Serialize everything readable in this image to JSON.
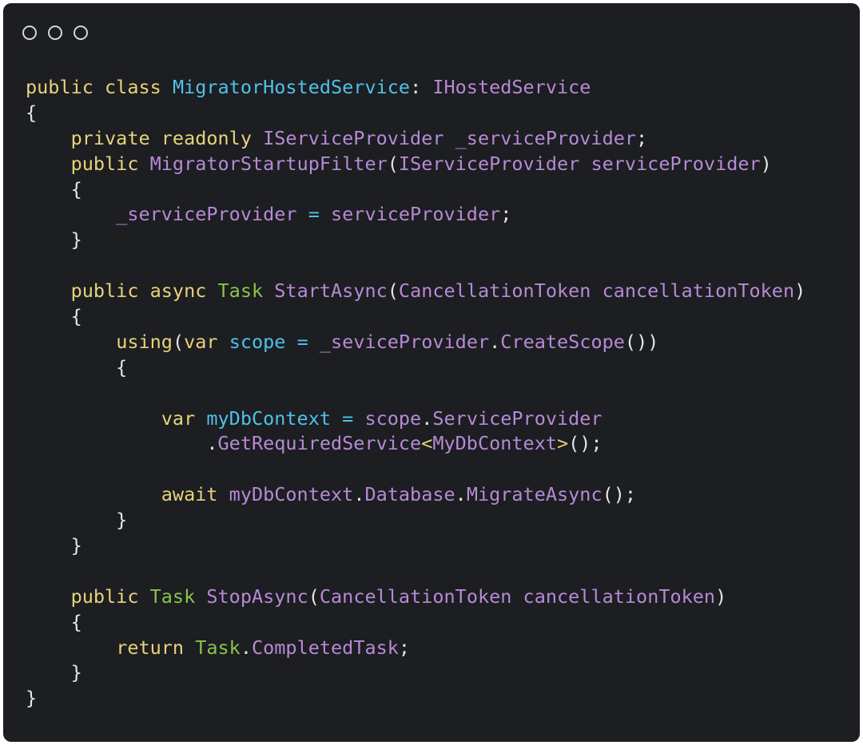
{
  "window": {
    "controls": [
      "circle-icon",
      "circle-icon",
      "circle-icon"
    ]
  },
  "code": {
    "lines": [
      [
        {
          "t": "public class ",
          "k": "kw"
        },
        {
          "t": "MigratorHostedService",
          "k": "cls"
        },
        {
          "t": ": ",
          "k": "punct"
        },
        {
          "t": "IHostedService",
          "k": "type"
        }
      ],
      [
        {
          "t": "{",
          "k": "punct"
        }
      ],
      [
        {
          "t": "    ",
          "k": "punct"
        },
        {
          "t": "private readonly ",
          "k": "kw"
        },
        {
          "t": "IServiceProvider _serviceProvider",
          "k": "type"
        },
        {
          "t": ";",
          "k": "punct"
        }
      ],
      [
        {
          "t": "    ",
          "k": "punct"
        },
        {
          "t": "public ",
          "k": "kw"
        },
        {
          "t": "MigratorStartupFilter",
          "k": "type"
        },
        {
          "t": "(",
          "k": "punct"
        },
        {
          "t": "IServiceProvider serviceProvider",
          "k": "type"
        },
        {
          "t": ")",
          "k": "punct"
        }
      ],
      [
        {
          "t": "    {",
          "k": "punct"
        }
      ],
      [
        {
          "t": "        ",
          "k": "punct"
        },
        {
          "t": "_serviceProvider",
          "k": "type"
        },
        {
          "t": " = ",
          "k": "op"
        },
        {
          "t": "serviceProvider",
          "k": "type"
        },
        {
          "t": ";",
          "k": "punct"
        }
      ],
      [
        {
          "t": "    }",
          "k": "punct"
        }
      ],
      [
        {
          "t": "",
          "k": "punct"
        }
      ],
      [
        {
          "t": "    ",
          "k": "punct"
        },
        {
          "t": "public async ",
          "k": "kw"
        },
        {
          "t": "Task ",
          "k": "task"
        },
        {
          "t": "StartAsync",
          "k": "type"
        },
        {
          "t": "(",
          "k": "punct"
        },
        {
          "t": "CancellationToken cancellationToken",
          "k": "type"
        },
        {
          "t": ")",
          "k": "punct"
        }
      ],
      [
        {
          "t": "    {",
          "k": "punct"
        }
      ],
      [
        {
          "t": "        ",
          "k": "punct"
        },
        {
          "t": "using",
          "k": "kw"
        },
        {
          "t": "(",
          "k": "punct"
        },
        {
          "t": "var ",
          "k": "kw"
        },
        {
          "t": "scope",
          "k": "var"
        },
        {
          "t": " = ",
          "k": "op"
        },
        {
          "t": "_seviceProvider",
          "k": "type"
        },
        {
          "t": ".",
          "k": "punct"
        },
        {
          "t": "CreateScope",
          "k": "type"
        },
        {
          "t": "())",
          "k": "punct"
        }
      ],
      [
        {
          "t": "        {",
          "k": "punct"
        }
      ],
      [
        {
          "t": "",
          "k": "punct"
        }
      ],
      [
        {
          "t": "            ",
          "k": "punct"
        },
        {
          "t": "var ",
          "k": "kw"
        },
        {
          "t": "myDbContext",
          "k": "var"
        },
        {
          "t": " = ",
          "k": "op"
        },
        {
          "t": "scope",
          "k": "type"
        },
        {
          "t": ".",
          "k": "punct"
        },
        {
          "t": "ServiceProvider",
          "k": "type"
        }
      ],
      [
        {
          "t": "                .",
          "k": "punct"
        },
        {
          "t": "GetRequiredService",
          "k": "type"
        },
        {
          "t": "<",
          "k": "gen"
        },
        {
          "t": "MyDbContext",
          "k": "type"
        },
        {
          "t": ">",
          "k": "gen"
        },
        {
          "t": "();",
          "k": "punct"
        }
      ],
      [
        {
          "t": "",
          "k": "punct"
        }
      ],
      [
        {
          "t": "            ",
          "k": "punct"
        },
        {
          "t": "await ",
          "k": "kw"
        },
        {
          "t": "myDbContext",
          "k": "type"
        },
        {
          "t": ".",
          "k": "punct"
        },
        {
          "t": "Database",
          "k": "type"
        },
        {
          "t": ".",
          "k": "punct"
        },
        {
          "t": "MigrateAsync",
          "k": "type"
        },
        {
          "t": "();",
          "k": "punct"
        }
      ],
      [
        {
          "t": "        }",
          "k": "punct"
        }
      ],
      [
        {
          "t": "    }",
          "k": "punct"
        }
      ],
      [
        {
          "t": "",
          "k": "punct"
        }
      ],
      [
        {
          "t": "    ",
          "k": "punct"
        },
        {
          "t": "public ",
          "k": "kw"
        },
        {
          "t": "Task ",
          "k": "task"
        },
        {
          "t": "StopAsync",
          "k": "type"
        },
        {
          "t": "(",
          "k": "punct"
        },
        {
          "t": "CancellationToken cancellationToken",
          "k": "type"
        },
        {
          "t": ")",
          "k": "punct"
        }
      ],
      [
        {
          "t": "    {",
          "k": "punct"
        }
      ],
      [
        {
          "t": "        ",
          "k": "punct"
        },
        {
          "t": "return ",
          "k": "kw"
        },
        {
          "t": "Task",
          "k": "task"
        },
        {
          "t": ".",
          "k": "punct"
        },
        {
          "t": "CompletedTask",
          "k": "type"
        },
        {
          "t": ";",
          "k": "punct"
        }
      ],
      [
        {
          "t": "    }",
          "k": "punct"
        }
      ],
      [
        {
          "t": "}",
          "k": "punct"
        }
      ]
    ]
  }
}
